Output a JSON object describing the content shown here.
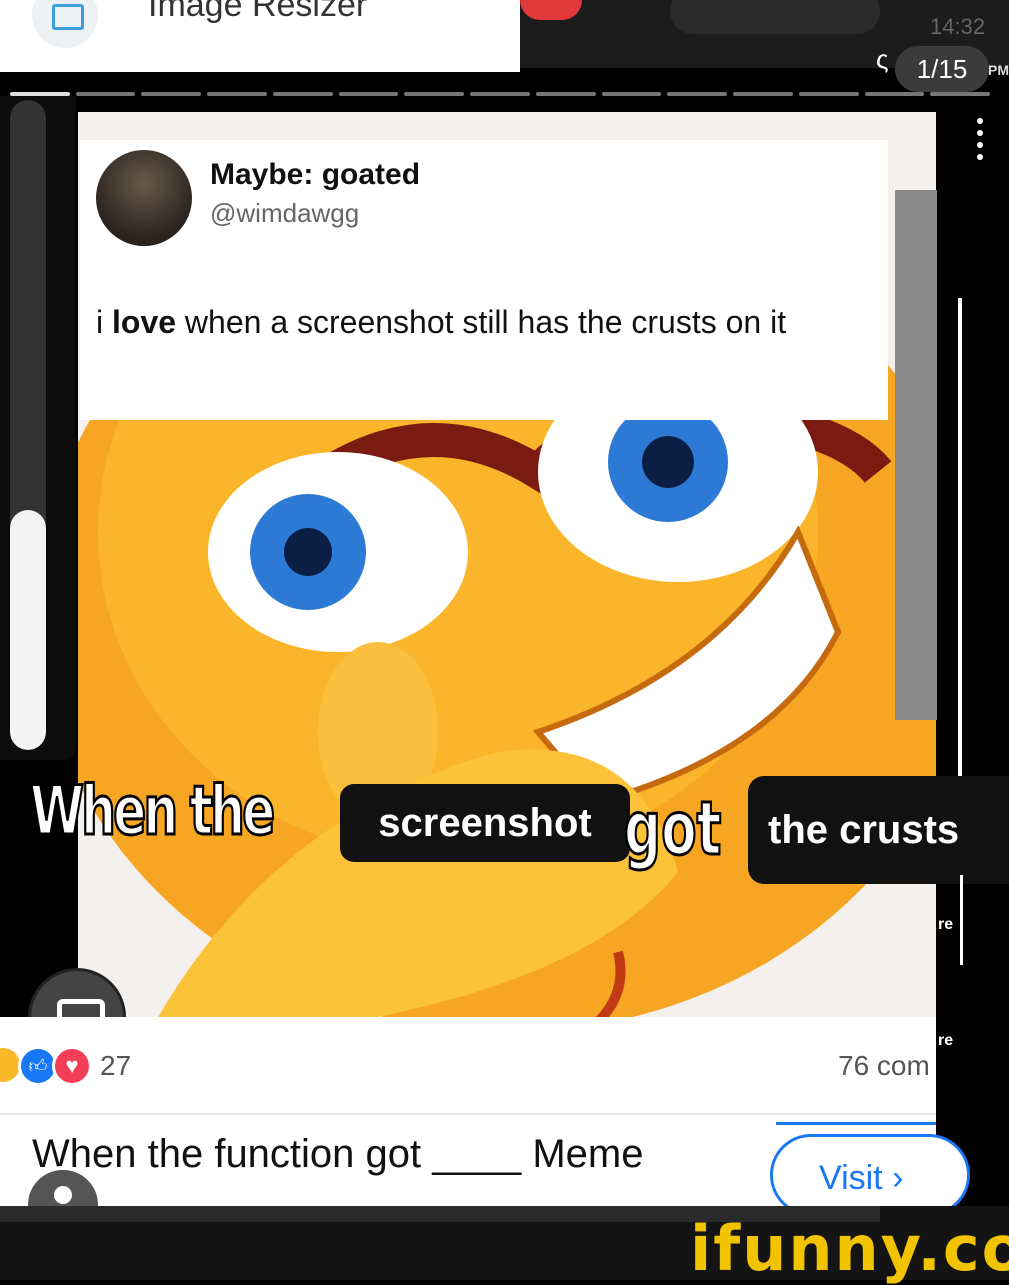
{
  "app": {
    "title": "Image Resizer"
  },
  "status": {
    "time": "14:32",
    "ampm": "PM",
    "page_counter": "1/15",
    "counter_glyph": "ς"
  },
  "story_progress": {
    "count": 15,
    "current": 1
  },
  "left_slider": {
    "fill_percent": 37
  },
  "tweet": {
    "display_name": "Maybe: goated",
    "handle": "@wimdawgg",
    "text_lead": "i ",
    "text_bold": "love",
    "text_rest": " when a screenshot still has the crusts on it"
  },
  "caption": {
    "when_the": "When the",
    "blank_fill": "screenshot",
    "got": "got",
    "ending": "the crusts"
  },
  "edge_labels": {
    "re": "re"
  },
  "post": {
    "reactions": "27",
    "comments": "76 com",
    "title": "When the function got ____ Meme",
    "visit_label": "Visit ›"
  },
  "watermark": "ifunny.co",
  "icons": [
    "image-resizer-app-icon",
    "kebab-menu-icon",
    "camera-icon",
    "user-avatar-icon",
    "haha-reaction-icon",
    "like-reaction-icon",
    "love-reaction-icon"
  ],
  "colors": {
    "fb_blue": "#1877f2",
    "ifunny_yellow": "#f2c400",
    "emoji_orange": "#f7a623"
  }
}
